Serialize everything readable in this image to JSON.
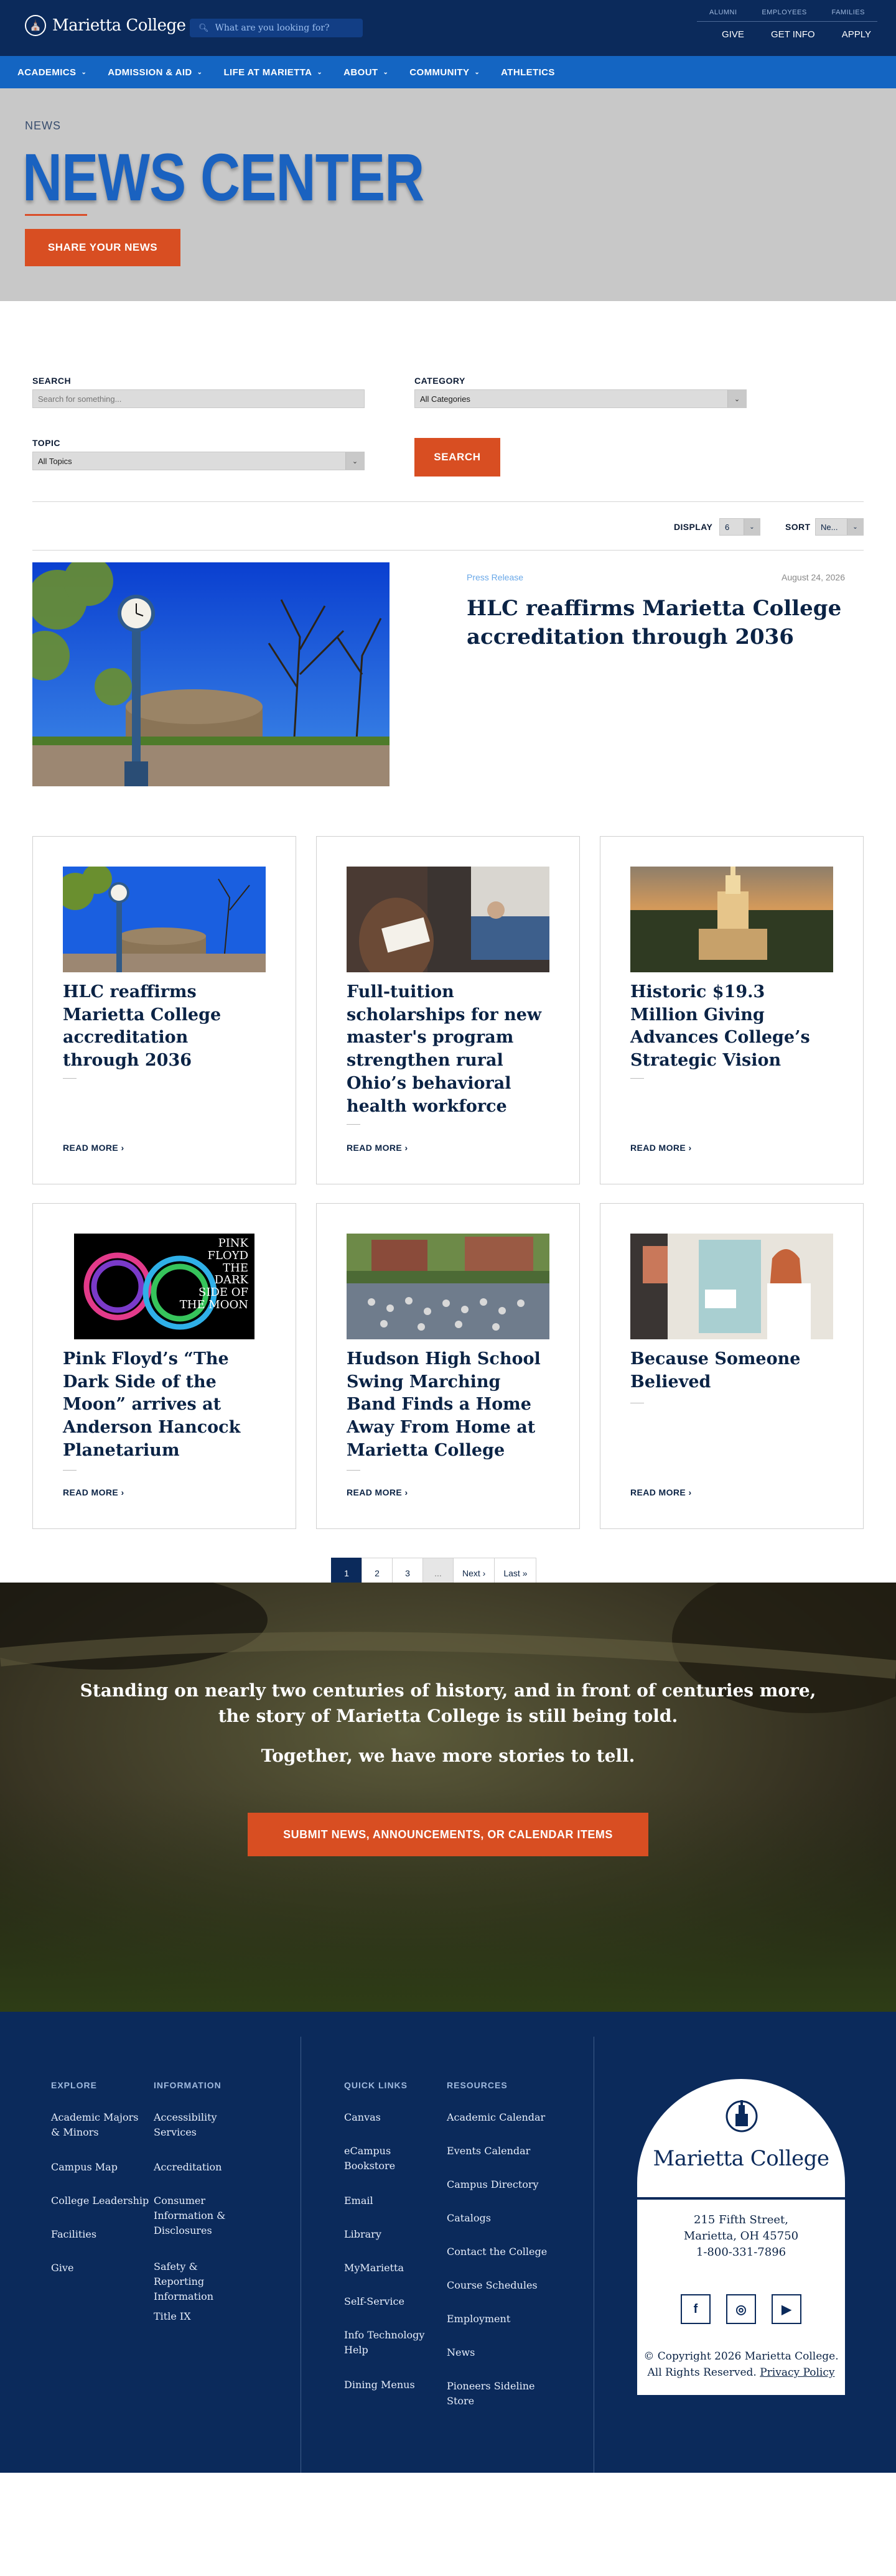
{
  "header": {
    "logo_text": "Marietta College",
    "search_placeholder": "What are you looking for?",
    "utility_links": [
      "ALUMNI",
      "EMPLOYEES",
      "FAMILIES"
    ],
    "utility_actions": [
      "GIVE",
      "GET INFO",
      "APPLY"
    ]
  },
  "nav": {
    "items": [
      {
        "label": "ACADEMICS",
        "has_menu": true
      },
      {
        "label": "ADMISSION & AID",
        "has_menu": true
      },
      {
        "label": "LIFE AT MARIETTA",
        "has_menu": true
      },
      {
        "label": "ABOUT",
        "has_menu": true
      },
      {
        "label": "COMMUNITY",
        "has_menu": true
      },
      {
        "label": "ATHLETICS",
        "has_menu": false
      }
    ]
  },
  "hero": {
    "eyebrow": "NEWS",
    "title": "NEWS CENTER",
    "button": "SHARE YOUR NEWS"
  },
  "filters": {
    "search_label": "SEARCH",
    "search_placeholder": "Search for something...",
    "category_label": "CATEGORY",
    "category_value": "All Categories",
    "topic_label": "TOPIC",
    "topic_value": "All Topics",
    "search_button": "SEARCH",
    "display_label": "DISPLAY",
    "display_value": "6",
    "sort_label": "SORT",
    "sort_value": "Ne..."
  },
  "featured": {
    "type": "Press Release",
    "date": "August 24, 2026",
    "title": "HLC reaffirms Marietta College accreditation through 2036"
  },
  "cards": [
    {
      "title": "HLC reaffirms Marietta College accreditation through 2036",
      "read_more": "READ MORE"
    },
    {
      "title": "Full-tuition scholarships for new master's program strengthen rural Ohio’s behavioral health workforce",
      "read_more": "READ MORE"
    },
    {
      "title": "Historic $19.3 Million Giving Advances College’s Strategic Vision",
      "read_more": "READ MORE"
    },
    {
      "title": "Pink Floyd’s “The Dark Side of the Moon” arrives at Anderson Hancock Planetarium",
      "read_more": "READ MORE",
      "image_text": [
        "PINK",
        "FLOYD",
        "THE",
        "DARK",
        "SIDE OF",
        "THE MOON"
      ]
    },
    {
      "title": "Hudson High School Swing Marching Band Finds a Home Away From Home at Marietta College",
      "read_more": "READ MORE"
    },
    {
      "title": "Because Someone Believed",
      "read_more": "READ MORE"
    }
  ],
  "pagination": [
    "1",
    "2",
    "3",
    "...",
    "Next ›",
    "Last »"
  ],
  "story": {
    "line1": "Standing on nearly two centuries of history, and in front of centuries more,",
    "line1b": "the story of Marietta College is still being told.",
    "line2": "Together, we have more stories to tell.",
    "button": "SUBMIT NEWS, ANNOUNCEMENTS, OR CALENDAR ITEMS"
  },
  "footer": {
    "explore": {
      "heading": "EXPLORE",
      "links": [
        "Academic Majors & Minors",
        "Campus Map",
        "College Leadership",
        "Facilities",
        "Give"
      ]
    },
    "information": {
      "heading": "INFORMATION",
      "links": [
        "Accessibility Services",
        "Accreditation",
        "Consumer Information & Disclosures",
        "Safety & Reporting Information",
        "Title IX"
      ]
    },
    "quick_links": {
      "heading": "QUICK LINKS",
      "links": [
        "Canvas",
        "eCampus Bookstore",
        "Email",
        "Library",
        "MyMarietta",
        "Self-Service",
        "Info Technology Help",
        "Dining Menus"
      ]
    },
    "resources": {
      "heading": "RESOURCES",
      "links": [
        "Academic Calendar",
        "Events Calendar",
        "Campus Directory",
        "Catalogs",
        "Contact the College",
        "Course Schedules",
        "Employment",
        "News",
        "Pioneers Sideline Store"
      ]
    },
    "card": {
      "name": "Marietta College",
      "street": "215 Fifth Street,",
      "city": "Marietta, OH 45750",
      "phone": "1-800-331-7896",
      "social": [
        "f",
        "◎",
        "▶"
      ],
      "copyright": "© Copyright 2026 Marietta College.",
      "rights": "All Rights Reserved.",
      "privacy": "Privacy Policy"
    }
  }
}
